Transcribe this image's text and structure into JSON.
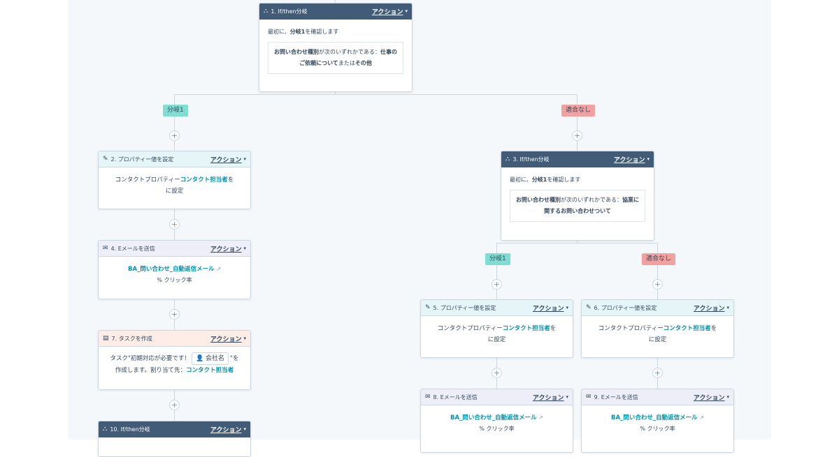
{
  "action_label": "アクション",
  "caret": "▾",
  "plus": "+",
  "external_icon_glyph": "↗",
  "branch_tags": {
    "branch1": "分岐1",
    "no_match": "適合なし"
  },
  "card1": {
    "title": "1. If/then分岐",
    "intro_prefix": "最初に、",
    "intro_branch": "分岐1",
    "intro_suffix": "を確認します",
    "cond_prop": "お問い合わせ種別",
    "cond_text": "が次のいずれかである：",
    "cond_val1": "仕事のご依頼について",
    "cond_or": "または",
    "cond_val2": "その他"
  },
  "card2": {
    "title": "2. プロパティー値を設定",
    "text1": "コンタクトプロパティー",
    "link": "コンタクト担当者",
    "text2": "を",
    "text3": "に設定"
  },
  "card3": {
    "title": "3. If/then分岐",
    "intro_prefix": "最初に、",
    "intro_branch": "分岐1",
    "intro_suffix": "を確認します",
    "cond_prop": "お問い合わせ種別",
    "cond_text": "が次のいずれかである：",
    "cond_val1": "協業に関するお問い合わせついて"
  },
  "card4": {
    "title": "4. Eメールを送信",
    "email": "BA_問い合わせ_自動返信メール",
    "stat": "% クリック率"
  },
  "card5": {
    "title": "5. プロパティー値を設定",
    "text1": "コンタクトプロパティー",
    "link": "コンタクト担当者",
    "text2": "を",
    "text3": "に設定"
  },
  "card6": {
    "title": "6. プロパティー値を設定",
    "text1": "コンタクトプロパティー",
    "link": "コンタクト担当者",
    "text2": "を",
    "text3": "に設定"
  },
  "card7": {
    "title": "7. タスクを作成",
    "text1": "タスク\"初期対応が必要です！",
    "chip": "会社名",
    "text2": "\"を",
    "text3": "作成します。割り当て先：",
    "assignee": "コンタクト担当者"
  },
  "card8": {
    "title": "8. Eメールを送信",
    "email": "BA_問い合わせ_自動返信メール",
    "stat": "% クリック率"
  },
  "card9": {
    "title": "9. Eメールを送信",
    "email": "BA_問い合わせ_自動返信メール",
    "stat": "% クリック率"
  },
  "card10": {
    "title": "10. If/then分岐"
  }
}
